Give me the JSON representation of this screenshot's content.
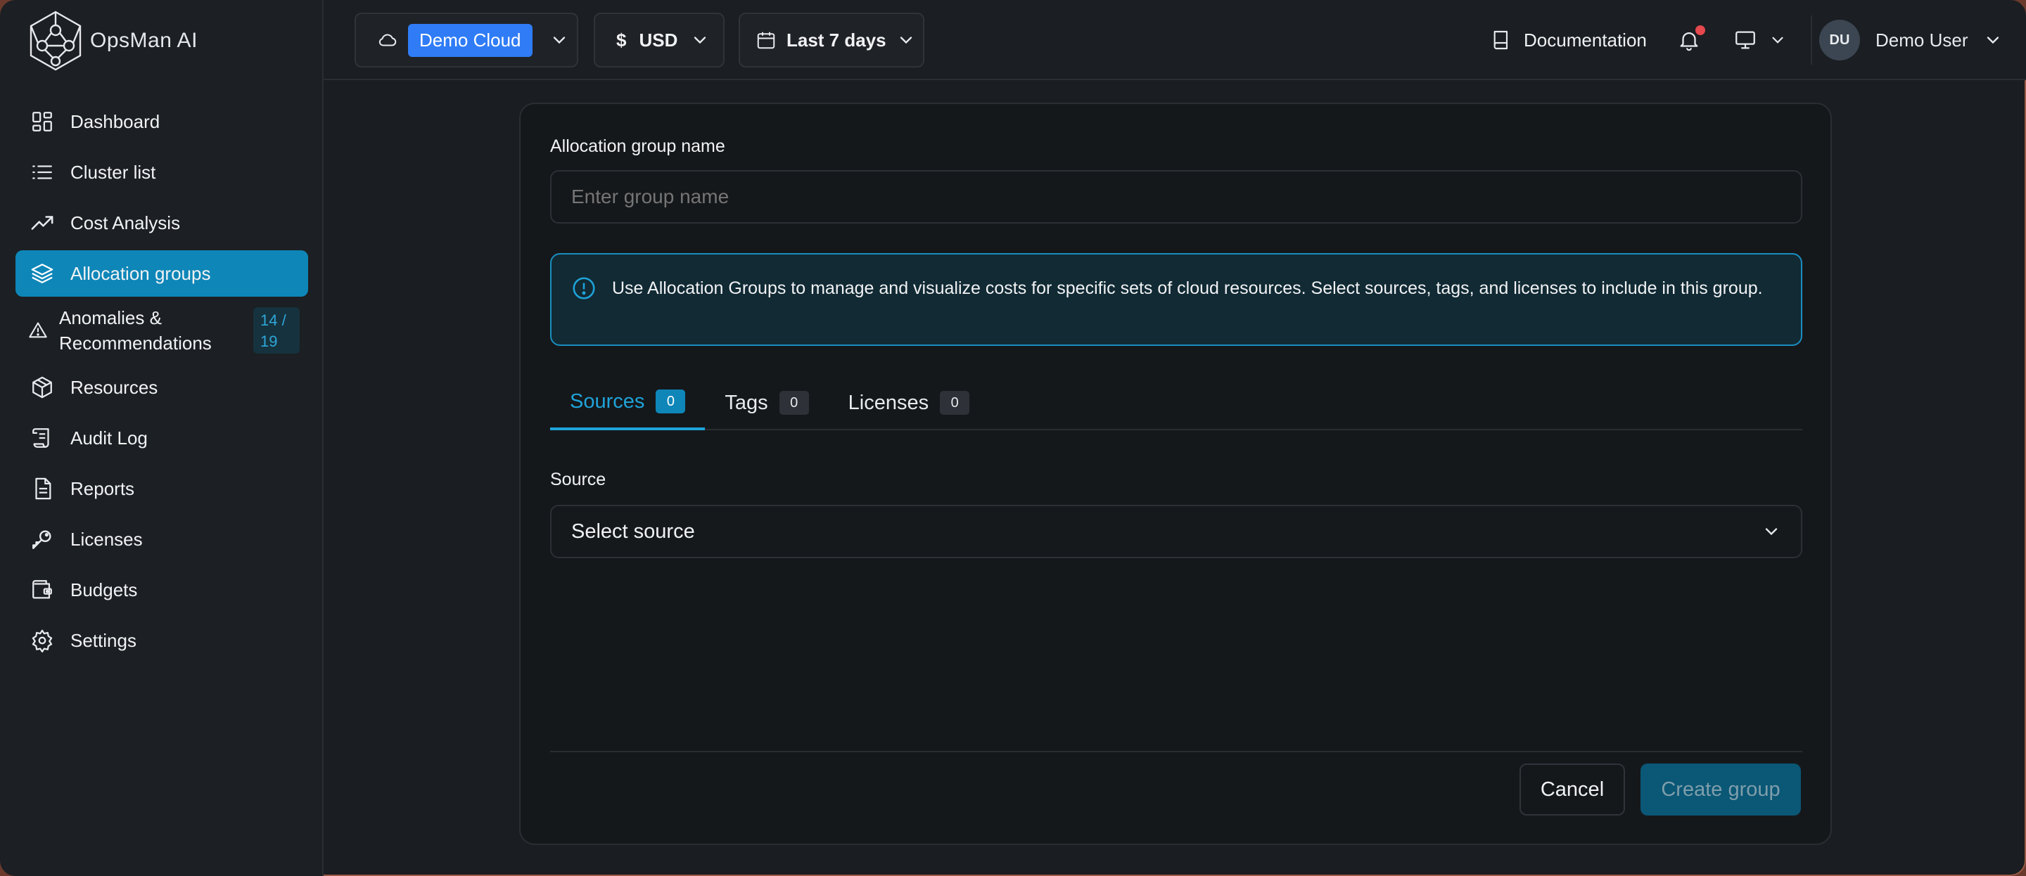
{
  "app": {
    "name": "OpsMan AI"
  },
  "sidebar": {
    "items": [
      {
        "label": "Dashboard",
        "icon": "dashboard-icon"
      },
      {
        "label": "Cluster list",
        "icon": "list-icon"
      },
      {
        "label": "Cost Analysis",
        "icon": "trend-icon"
      },
      {
        "label": "Allocation groups",
        "icon": "layers-icon",
        "active": true
      },
      {
        "label": "Anomalies & Recommendations",
        "icon": "warning-icon",
        "badge": "14 / 19"
      },
      {
        "label": "Resources",
        "icon": "cube-icon"
      },
      {
        "label": "Audit Log",
        "icon": "scroll-icon"
      },
      {
        "label": "Reports",
        "icon": "document-icon"
      },
      {
        "label": "Licenses",
        "icon": "key-icon"
      },
      {
        "label": "Budgets",
        "icon": "wallet-icon"
      },
      {
        "label": "Settings",
        "icon": "gear-icon"
      }
    ]
  },
  "topbar": {
    "cloud": "Demo Cloud",
    "currency_symbol": "$",
    "currency": "USD",
    "date_range": "Last 7 days",
    "documentation": "Documentation",
    "user_initials": "DU",
    "user_name": "Demo User",
    "notification_dot_color": "#e5484d"
  },
  "form": {
    "group_name_label": "Allocation group name",
    "group_name_placeholder": "Enter group name",
    "group_name_value": "",
    "info_text": "Use Allocation Groups to manage and visualize costs for specific sets of cloud resources. Select sources, tags, and licenses to include in this group.",
    "tabs": [
      {
        "label": "Sources",
        "count": "0",
        "active": true
      },
      {
        "label": "Tags",
        "count": "0"
      },
      {
        "label": "Licenses",
        "count": "0"
      }
    ],
    "source_label": "Source",
    "source_select": "Select source",
    "cancel": "Cancel",
    "create": "Create group"
  },
  "colors": {
    "accent": "#0e86b8",
    "cloud_tag": "#2f7cf6",
    "background": "#15181b"
  }
}
